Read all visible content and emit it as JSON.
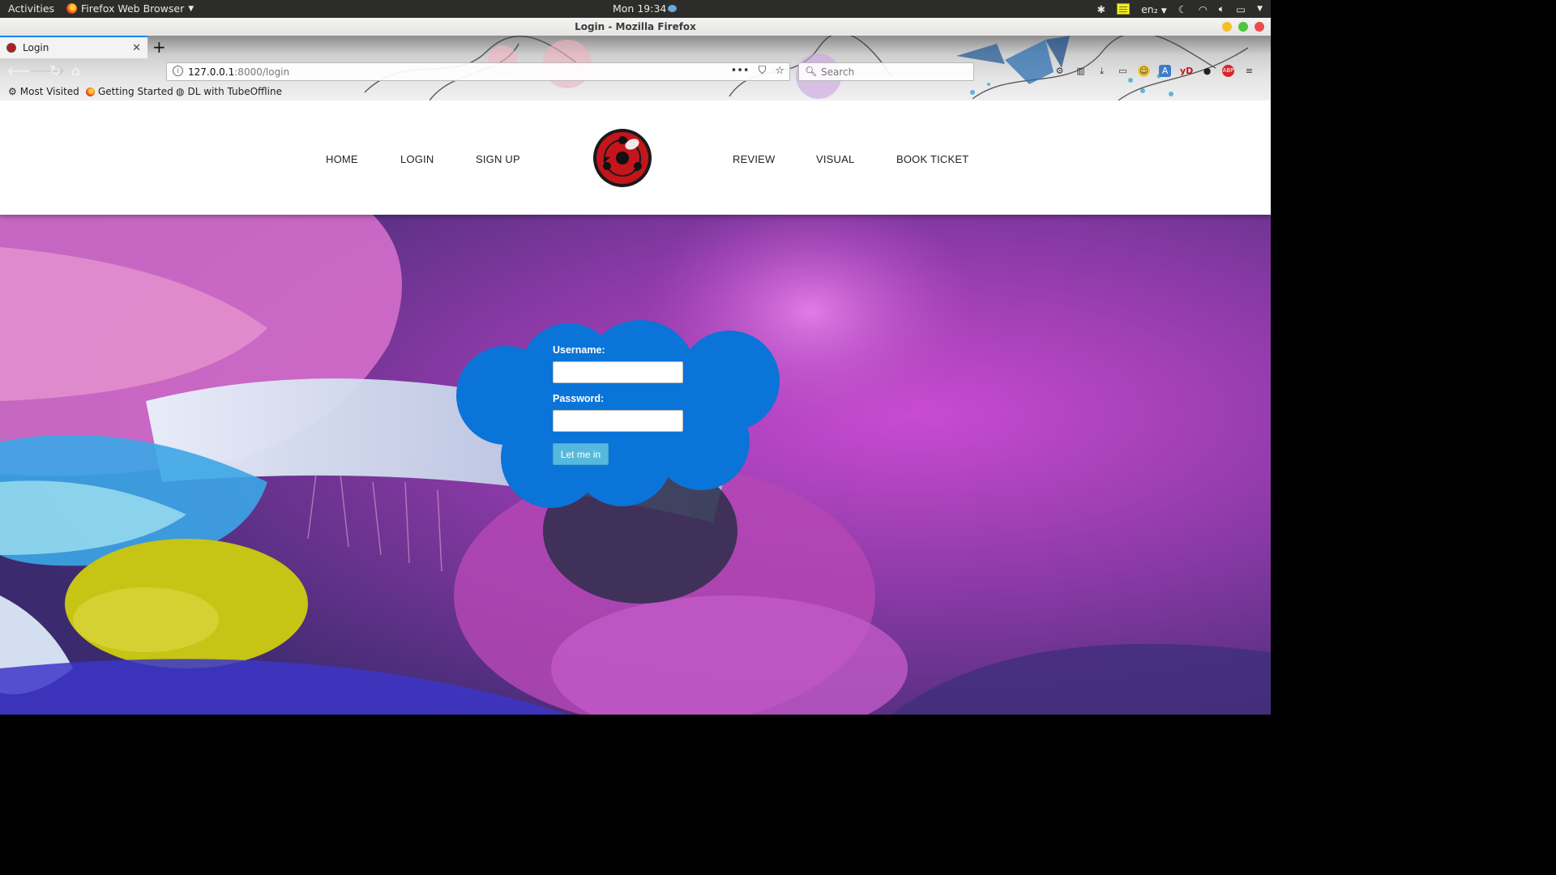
{
  "system_bar": {
    "activities": "Activities",
    "app_menu": "Firefox Web Browser",
    "clock": "Mon 19:34",
    "keyboard_layout": "en₂"
  },
  "window": {
    "title": "Login - Mozilla Firefox"
  },
  "browser": {
    "tab_title": "Login",
    "new_tab_label": "+",
    "tab_close": "✕",
    "url_host": "127.0.0.1",
    "url_path": ":8000/login",
    "search_placeholder": "Search",
    "page_actions": [
      "•••",
      "⛉",
      "☆"
    ],
    "bookmarks": [
      {
        "label": "Most Visited",
        "icon": "gear-icon"
      },
      {
        "label": "Getting Started",
        "icon": "firefox-icon"
      },
      {
        "label": "DL with TubeOffline",
        "icon": "globe-icon"
      }
    ],
    "colors": {
      "active_tab_accent": "#0a84ff"
    }
  },
  "site": {
    "nav_left": [
      "HOME",
      "LOGIN",
      "SIGN UP"
    ],
    "nav_right": [
      "REVIEW",
      "VISUAL",
      "BOOK TICKET"
    ],
    "logo": "sharingan-logo"
  },
  "login": {
    "username_label": "Username:",
    "username_value": "",
    "password_label": "Password:",
    "password_value": "",
    "submit_label": "Let me in",
    "colors": {
      "cloud": "#0a74d8",
      "button": "#54b9dd"
    }
  }
}
